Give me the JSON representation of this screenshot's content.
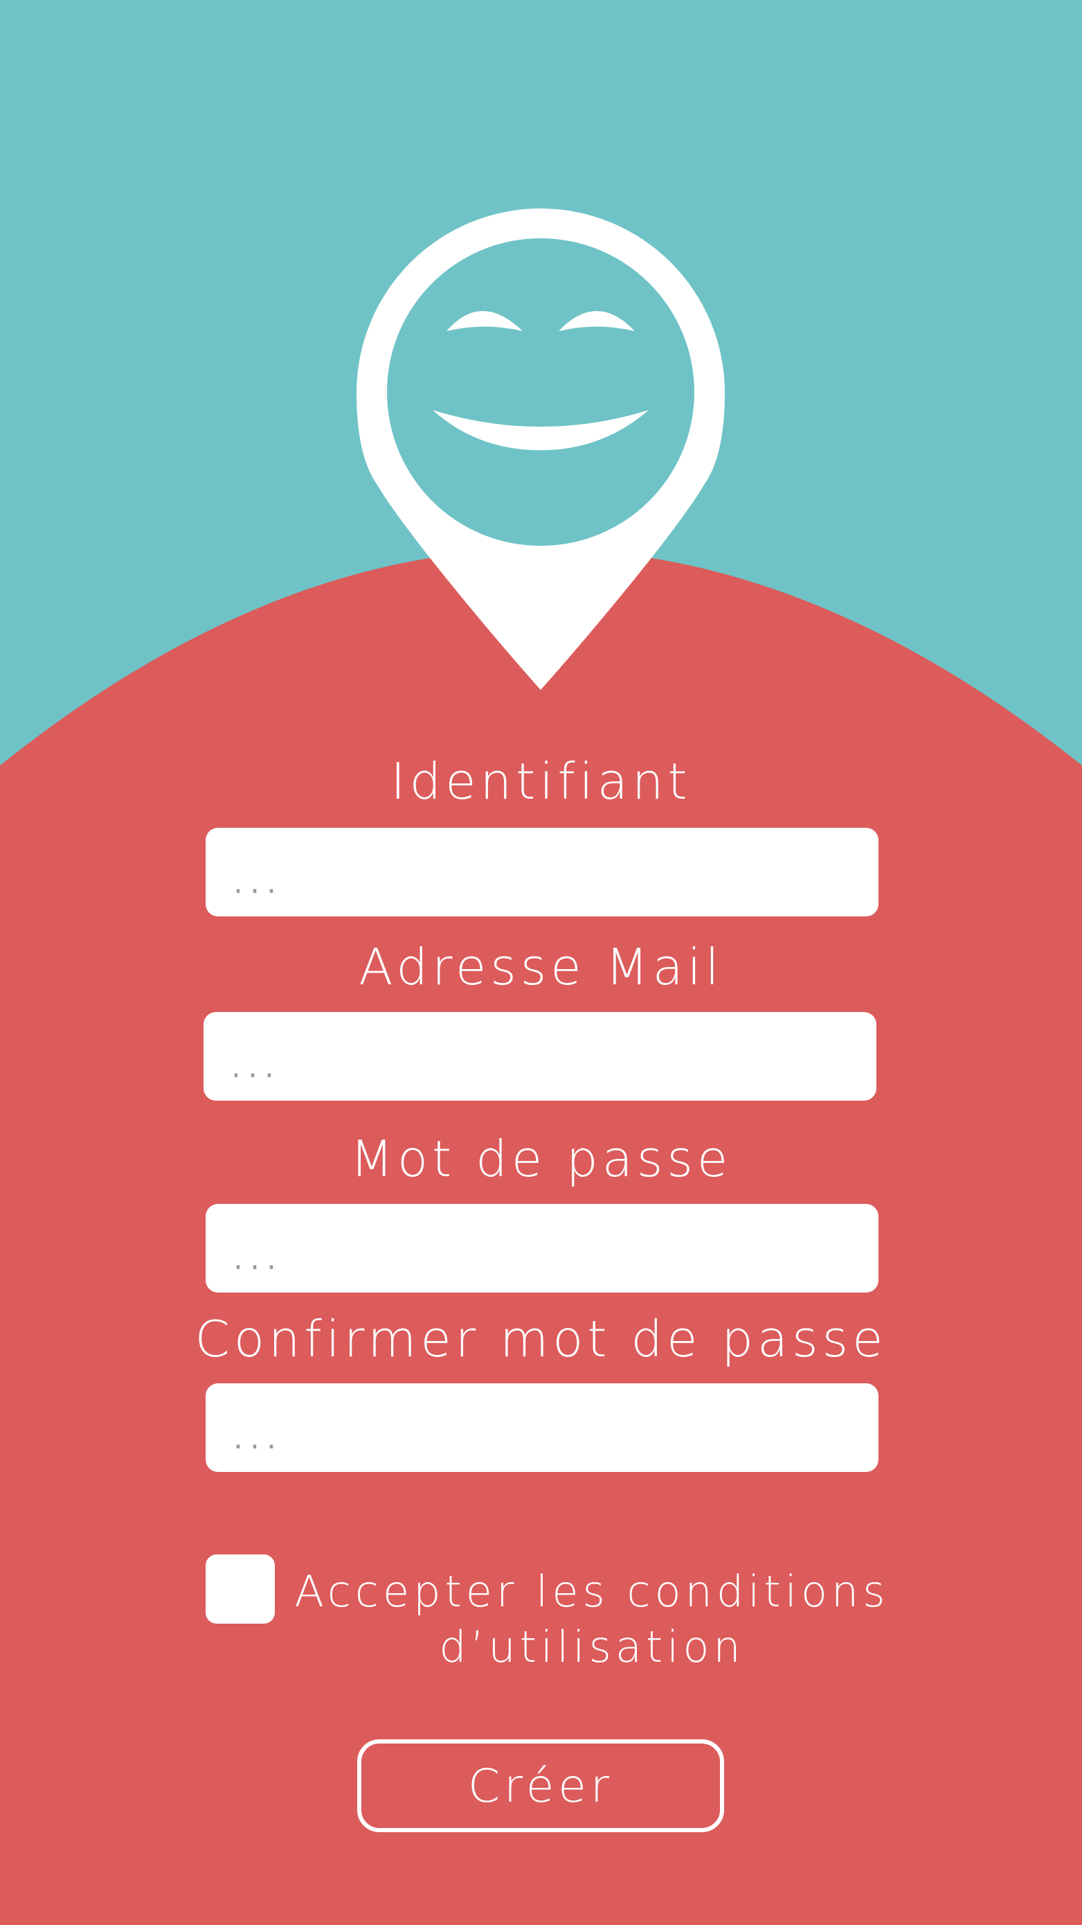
{
  "colors": {
    "sky": "#6fc3c6",
    "background": "#dc5b5b",
    "foreground": "#ffffff"
  },
  "logo": {
    "icon": "smiley-location-pin-icon"
  },
  "form": {
    "username": {
      "label": "Identifiant",
      "placeholder": "..."
    },
    "email": {
      "label": "Adresse Mail",
      "placeholder": "..."
    },
    "password": {
      "label": "Mot de passe",
      "placeholder": "..."
    },
    "confirm_password": {
      "label": "Confirmer mot de passe",
      "placeholder": "..."
    },
    "terms": {
      "checked": false,
      "label_line1": "Accepter les conditions",
      "label_line2": "d’utilisation"
    },
    "submit_label": "Créer"
  }
}
